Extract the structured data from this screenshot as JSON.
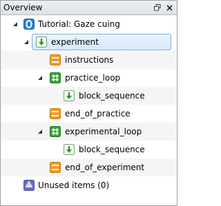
{
  "panel": {
    "title": "Overview"
  },
  "tree": {
    "rows": [
      {
        "label": "Tutorial: Gaze cuing",
        "icon": "opensesame-icon",
        "expanded": true
      },
      {
        "label": "experiment",
        "icon": "sequence-icon",
        "expanded": true,
        "selected": true
      },
      {
        "label": "instructions",
        "icon": "sketchpad-icon"
      },
      {
        "label": "practice_loop",
        "icon": "loop-icon",
        "expanded": true
      },
      {
        "label": "block_sequence",
        "icon": "sequence-icon"
      },
      {
        "label": "end_of_practice",
        "icon": "sketchpad-icon"
      },
      {
        "label": "experimental_loop",
        "icon": "loop-icon",
        "expanded": true
      },
      {
        "label": "block_sequence",
        "icon": "sequence-icon"
      },
      {
        "label": "end_of_experiment",
        "icon": "sketchpad-icon"
      },
      {
        "label": "Unused items (0)",
        "icon": "recycle-icon"
      }
    ]
  }
}
